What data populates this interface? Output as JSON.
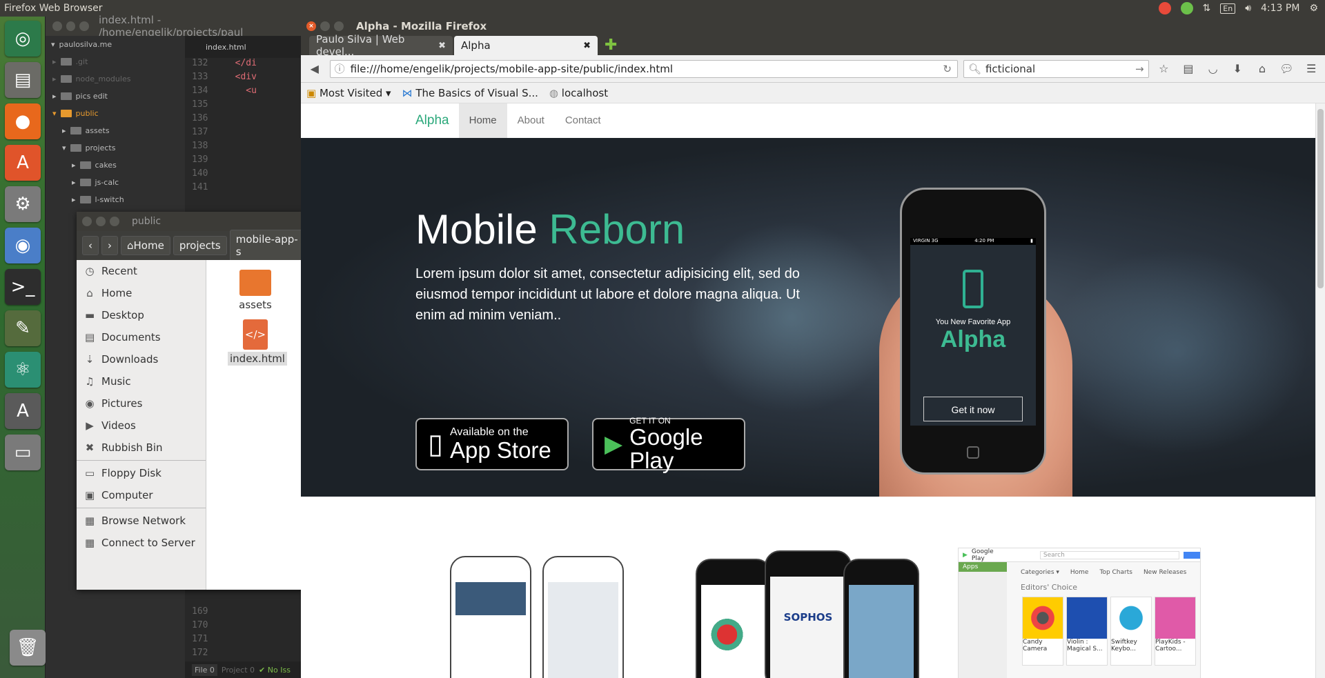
{
  "topbar": {
    "title": "Firefox Web Browser",
    "kb": "En",
    "time": "4:13 PM"
  },
  "editor": {
    "title": "index.html - /home/engelik/projects/paul",
    "tab": "index.html",
    "tree": [
      "paulosilva.me",
      ".git",
      "node_modules",
      "pics edit",
      "public",
      "assets",
      "projects",
      "cakes",
      "js-calc",
      "l-switch"
    ],
    "lines_top": [
      "132",
      "133",
      "134",
      "135",
      "136",
      "137",
      "138",
      "139",
      "140",
      "141"
    ],
    "code": [
      "</di",
      "<div",
      "<u"
    ],
    "lines_bottom": [
      "169",
      "170",
      "171",
      "172"
    ],
    "status": {
      "file": "File 0",
      "project": "Project 0",
      "issues": "✔ No Iss"
    }
  },
  "files": {
    "title": "public",
    "path": [
      "Home",
      "projects",
      "mobile-app-s"
    ],
    "sidebar": [
      {
        "label": "Recent",
        "icon": "◷"
      },
      {
        "label": "Home",
        "icon": "⌂"
      },
      {
        "label": "Desktop",
        "icon": "▬"
      },
      {
        "label": "Documents",
        "icon": "▤"
      },
      {
        "label": "Downloads",
        "icon": "⇣"
      },
      {
        "label": "Music",
        "icon": "♫"
      },
      {
        "label": "Pictures",
        "icon": "◉"
      },
      {
        "label": "Videos",
        "icon": "▶"
      },
      {
        "label": "Rubbish Bin",
        "icon": "✖"
      },
      {
        "label": "Floppy Disk",
        "icon": "▭"
      },
      {
        "label": "Computer",
        "icon": "▣"
      },
      {
        "label": "Browse Network",
        "icon": "▦"
      },
      {
        "label": "Connect to Server",
        "icon": "▦"
      }
    ],
    "items": [
      {
        "label": "assets"
      },
      {
        "label": "index.html"
      }
    ]
  },
  "firefox": {
    "title": "Alpha - Mozilla Firefox",
    "tabs": [
      "Paulo Silva | Web devel...",
      "Alpha"
    ],
    "url": "file:///home/engelik/projects/mobile-app-site/public/index.html",
    "search": "ficticional",
    "bookmarks": [
      "Most Visited",
      "The Basics of Visual S...",
      "localhost"
    ]
  },
  "site": {
    "brand": "Alpha",
    "nav": [
      "Home",
      "About",
      "Contact"
    ],
    "hero_title_1": "Mobile",
    "hero_title_2": "Reborn",
    "hero_text": "Lorem ipsum dolor sit amet, consectetur adipisicing elit, sed do eiusmod tempor incididunt ut labore et dolore magna aliqua. Ut enim ad minim veniam..",
    "appstore_small": "Available on the",
    "appstore_large": "App Store",
    "play_small": "GET IT ON",
    "play_large": "Google Play",
    "phone_status_left": "VIRGIN 3G",
    "phone_status_time": "4:20 PM",
    "phone_sub": "You New Favorite App",
    "phone_title": "Alpha",
    "phone_button": "Get it now",
    "sophos": "SOPHOS",
    "gp_title": "Google Play",
    "gp_search": "Search",
    "gp_apps": "Apps",
    "gp_editors": "Editors' Choice",
    "gp_menu": [
      "Categories ▾",
      "Home",
      "Top Charts",
      "New Releases"
    ],
    "gp_cards": [
      "Candy Camera",
      "Violin : Magical S...",
      "Swiftkey Keybo...",
      "PlayKids - Cartoo..."
    ]
  },
  "colors": {
    "accent": "#3dbb92",
    "ubuntu_panel": "#3c3b37"
  }
}
